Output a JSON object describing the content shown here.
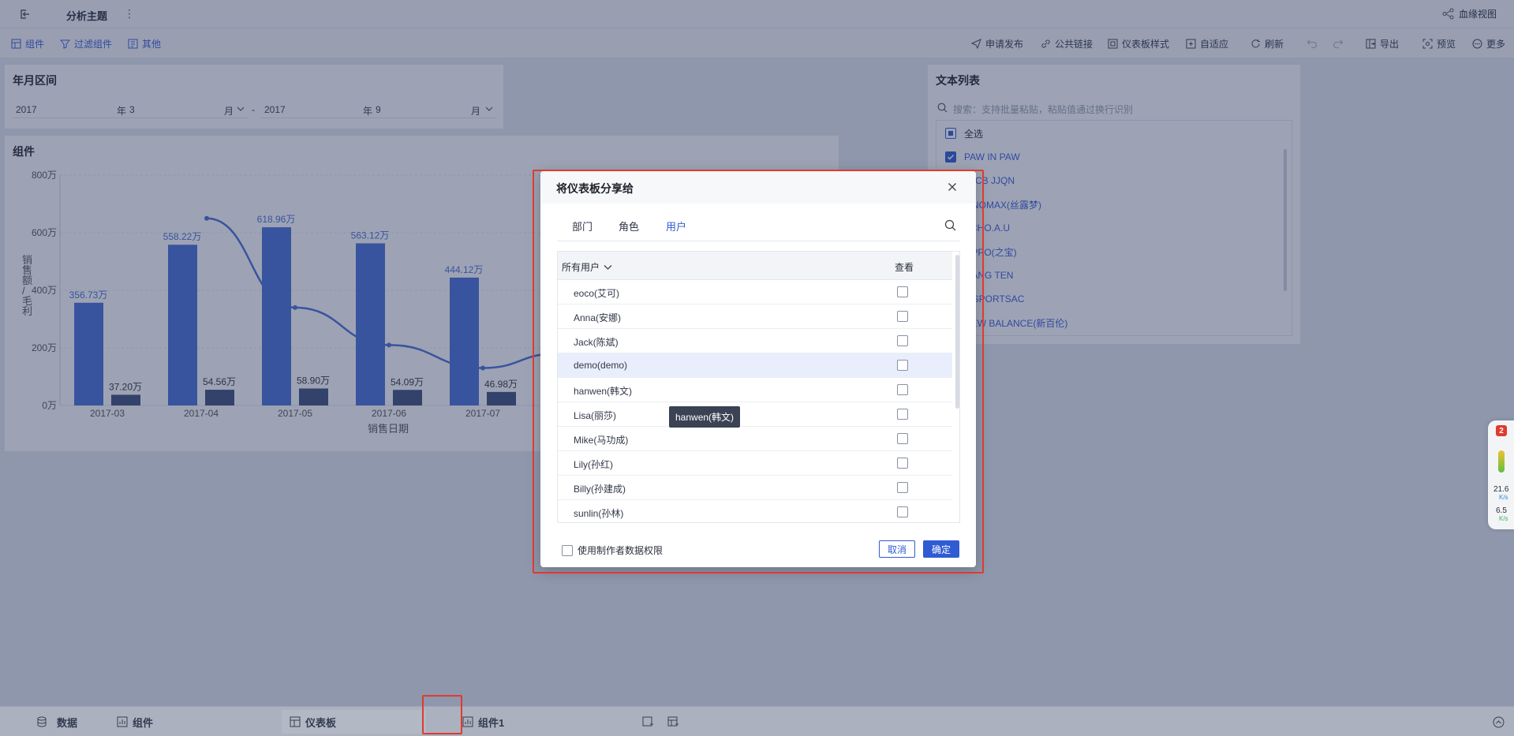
{
  "topbar": {
    "title": "分析主题",
    "lineage": "血缘视图"
  },
  "toolbar": {
    "left": [
      "组件",
      "过滤组件",
      "其他"
    ],
    "right": [
      "申请发布",
      "公共链接",
      "仪表板样式",
      "自适应",
      "刷新",
      "导出",
      "预览",
      "更多"
    ]
  },
  "year_filter": {
    "title": "年月区间",
    "start_year": "2017",
    "start_month": "3",
    "end_year": "2017",
    "end_month": "9",
    "year_unit": "年",
    "month_unit": "月",
    "separator": "-"
  },
  "chart_panel": {
    "title": "组件"
  },
  "chart_data": {
    "type": "bar",
    "categories": [
      "2017-03",
      "2017-04",
      "2017-05",
      "2017-06",
      "2017-07"
    ],
    "series": [
      {
        "values": [
          356.73,
          558.22,
          618.96,
          563.12,
          444.12
        ],
        "labels": [
          "356.73万",
          "558.22万",
          "618.96万",
          "563.12万",
          "444.12万"
        ],
        "color": "#4a6fd8"
      },
      {
        "values": [
          37.2,
          54.56,
          58.9,
          54.09,
          46.98
        ],
        "labels": [
          "37.20万",
          "54.56万",
          "58.90万",
          "54.09万",
          "46.98万"
        ],
        "color": "#3d4f78"
      },
      {
        "type": "line",
        "values": [
          null,
          650,
          340,
          210,
          130
        ],
        "color": "#4a6fd8"
      }
    ],
    "yticks": [
      "800万",
      "600万",
      "400万",
      "200万",
      "0万"
    ],
    "ylim": [
      0,
      800
    ],
    "xlabel": "销售日期",
    "ylabel": "销售额/毛利",
    "grid": true
  },
  "text_list": {
    "title": "文本列表",
    "search_placeholder": "搜索：支持批量粘贴，粘贴值通过换行识别",
    "items": [
      {
        "label": "全选",
        "checked": "partial"
      },
      {
        "label": "PAW IN PAW",
        "checked": true
      },
      {
        "label": "JACB JJQN",
        "checked": false
      },
      {
        "label": "LINOMAX(丝露梦)",
        "checked": false
      },
      {
        "label": "ECHO.A.U",
        "checked": false
      },
      {
        "label": "OPPO(之宝)",
        "checked": false
      },
      {
        "label": "JIANG TEN",
        "checked": false
      },
      {
        "label": "A SPORTSAC",
        "checked": false
      },
      {
        "label": "NEW BALANCE(新百伦)",
        "checked": false
      }
    ]
  },
  "dialog": {
    "title": "将仪表板分享给",
    "tabs": [
      "部门",
      "角色",
      "用户"
    ],
    "active_tab": "用户",
    "col_user": "所有用户",
    "col_view": "查看",
    "users": [
      "eoco(艾可)",
      "Anna(安娜)",
      "Jack(陈斌)",
      "demo(demo)",
      "hanwen(韩文)",
      "Lisa(丽莎)",
      "Mike(马功成)",
      "Lily(孙红)",
      "Billy(孙建成)",
      "sunlin(孙林)"
    ],
    "highlighted_user": "demo(demo)",
    "use_creator_permission": "使用制作者数据权限",
    "cancel": "取消",
    "ok": "确定"
  },
  "tooltip": "hanwen(韩文)",
  "bottombar": {
    "data": "数据",
    "component": "组件",
    "dashboard": "仪表板",
    "component1": "组件1"
  },
  "net_widget": {
    "badge": "2",
    "up_speed": "21.6",
    "up_unit": "K/s",
    "down_speed": "6.5",
    "down_unit": "K/s"
  },
  "colors": {
    "accent": "#2f5bd3",
    "bar_primary": "#4a6fd8",
    "bar_secondary": "#3d4f78",
    "highlight_box": "#e03a2f"
  }
}
